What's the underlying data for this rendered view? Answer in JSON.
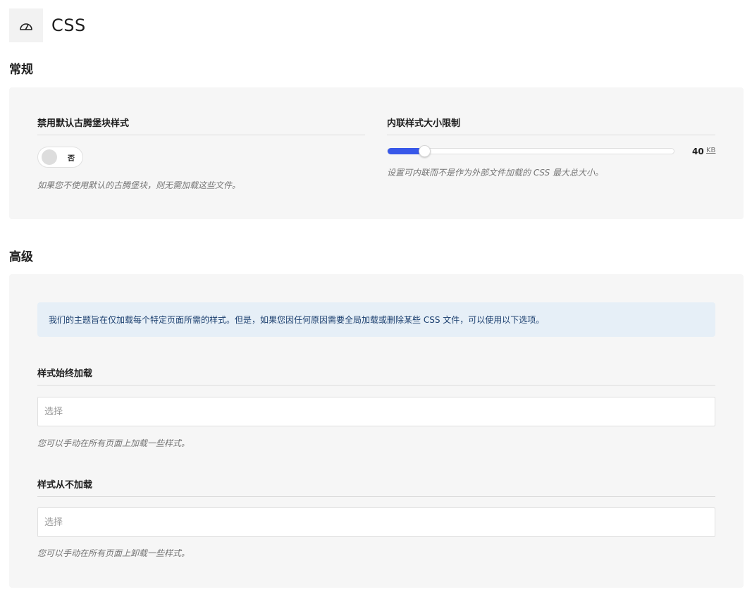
{
  "header": {
    "title": "CSS",
    "icon": "gauge-icon"
  },
  "sections": {
    "general": {
      "heading": "常规",
      "disable_block_styles": {
        "label": "禁用默认古腾堡块样式",
        "toggle_label": "否",
        "toggle_on": false,
        "description": "如果您不使用默认的古腾堡块，则无需加载这些文件。"
      },
      "inline_size_limit": {
        "label": "内联样式大小限制",
        "value": "40",
        "unit": "KB",
        "fraction": 0.13,
        "description": "设置可内联而不是作为外部文件加载的 CSS 最大总大小。"
      }
    },
    "advanced": {
      "heading": "高级",
      "notice": "我们的主题旨在仅加载每个特定页面所需的样式。但是，如果您因任何原因需要全局加载或删除某些 CSS 文件，可以使用以下选项。",
      "always_load": {
        "label": "样式始终加载",
        "placeholder": "选择",
        "description": "您可以手动在所有页面上加载一些样式。"
      },
      "never_load": {
        "label": "样式从不加载",
        "placeholder": "选择",
        "description": "您可以手动在所有页面上卸载一些样式。"
      }
    }
  },
  "colors": {
    "accent": "#3858e9",
    "panel_bg": "#f6f6f6",
    "notice_bg": "#e6eff7"
  }
}
